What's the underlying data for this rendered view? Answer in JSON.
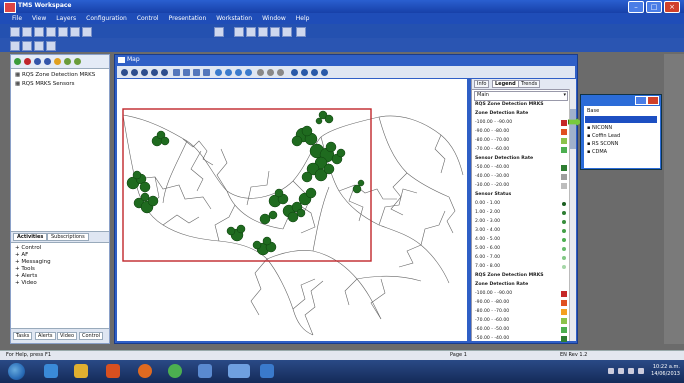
{
  "window": {
    "title": "TMS Workspace"
  },
  "menu": [
    "File",
    "View",
    "Layers",
    "Configuration",
    "Control",
    "Presentation",
    "Workstation",
    "Window",
    "Help"
  ],
  "left_panel": {
    "layers": [
      "RQS Zone Detection MRKS",
      "RQS MRKS Sensors"
    ],
    "tabs": [
      "Activities",
      "Subscriptions"
    ],
    "tree": [
      "Control",
      "AF",
      "Messaging",
      "Tools",
      "Alerts",
      "Video"
    ],
    "bottom_tabs": [
      "Tasks",
      "Alerts",
      "Video",
      "Control"
    ]
  },
  "map_window": {
    "title": "Map"
  },
  "legend": {
    "tabs": [
      "Info",
      "Legend",
      "Trends"
    ],
    "active_tab": "Legend",
    "combo": "Main",
    "sections": [
      {
        "heading": "RQS Zone Detection MRKS",
        "kind": "header"
      },
      {
        "heading": "Zone Detection Rate",
        "kind": "header"
      },
      {
        "label": "-100.00 - -90.00",
        "color": "#c62828",
        "kind": "swatch"
      },
      {
        "label": "-90.00 - -80.00",
        "color": "#e05020",
        "kind": "swatch"
      },
      {
        "label": "-80.00 - -70.00",
        "color": "#8bc34a",
        "kind": "swatch"
      },
      {
        "label": "-70.00 - -60.00",
        "color": "#4caf50",
        "kind": "swatch"
      },
      {
        "heading": "Sensor Detection Rate",
        "kind": "header"
      },
      {
        "label": "-50.00 - -40.00",
        "color": "#2e7d32",
        "kind": "swatch"
      },
      {
        "label": "-40.00 - -30.00",
        "color": "#9e9e9e",
        "kind": "swatch"
      },
      {
        "label": "-30.00 - -20.00",
        "color": "#bdbdbd",
        "kind": "swatch"
      },
      {
        "heading": "Sensor Status",
        "kind": "header"
      },
      {
        "label": "0.00 - 1.00",
        "color": "#1b5e20",
        "kind": "dot"
      },
      {
        "label": "1.00 - 2.00",
        "color": "#2e7d32",
        "kind": "dot"
      },
      {
        "label": "2.00 - 3.00",
        "color": "#388e3c",
        "kind": "dot"
      },
      {
        "label": "3.00 - 4.00",
        "color": "#43a047",
        "kind": "dot"
      },
      {
        "label": "4.00 - 5.00",
        "color": "#4caf50",
        "kind": "dot"
      },
      {
        "label": "5.00 - 6.00",
        "color": "#66bb6a",
        "kind": "dot"
      },
      {
        "label": "6.00 - 7.00",
        "color": "#81c784",
        "kind": "dot"
      },
      {
        "label": "7.00 - 8.00",
        "color": "#a5d6a7",
        "kind": "dot"
      },
      {
        "heading": "RQS Zone Detection MRKS",
        "kind": "header"
      },
      {
        "heading": "Zone Detection Rate",
        "kind": "header"
      },
      {
        "label": "-100.00 - -90.00",
        "color": "#c62828",
        "kind": "swatch"
      },
      {
        "label": "-90.00 - -80.00",
        "color": "#e05020",
        "kind": "swatch"
      },
      {
        "label": "-80.00 - -70.00",
        "color": "#f4a020",
        "kind": "swatch"
      },
      {
        "label": "-70.00 - -60.00",
        "color": "#8bc34a",
        "kind": "swatch"
      },
      {
        "label": "-60.00 - -50.00",
        "color": "#4caf50",
        "kind": "swatch"
      },
      {
        "label": "-50.00 - -40.00",
        "color": "#2e7d32",
        "kind": "swatch"
      }
    ]
  },
  "popup": {
    "items": [
      "Base",
      "",
      "NICONN",
      "Coffin Lead",
      "RS SCONN",
      "CDMA"
    ],
    "selected_index": 1
  },
  "status": {
    "left": "For Help, press F1",
    "middle": "Page 1",
    "right": "EN Rev 1.2"
  },
  "clock": {
    "time": "10:22 a.m.",
    "date": "14/06/2013"
  },
  "colors": {
    "sensor_cluster": "#1f6b1f",
    "selection_box": "#c0262b",
    "titlebar": "#1f4db8"
  }
}
